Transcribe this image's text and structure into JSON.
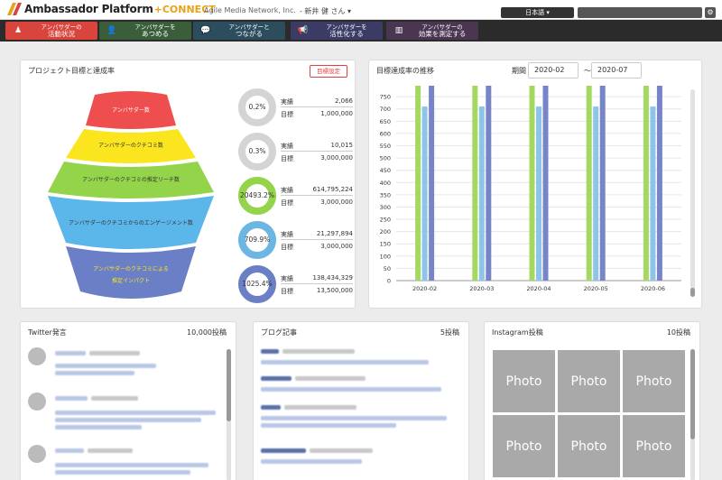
{
  "header": {
    "logo_text": "Ambassador Platform",
    "logo_plus": "+CONNECT",
    "company": "Agile Media Network, Inc.",
    "user": "- 新井 健 さん ▾",
    "language": "日本語 ▾",
    "brand_color": "#e8a21a"
  },
  "nav": {
    "items": [
      {
        "top": "アンバサダーの",
        "main": "活動状況",
        "icon": "person-icon",
        "color": "#d9443c"
      },
      {
        "top": "アンバサダーを",
        "main": "あつめる",
        "icon": "add-user-icon",
        "color": "#3a5e3a"
      },
      {
        "top": "アンバサダーと",
        "main": "つながる",
        "icon": "chat-icon",
        "color": "#2b4d5e"
      },
      {
        "top": "アンバサダーを",
        "main": "活性化する",
        "icon": "megaphone-icon",
        "color": "#3b3b66"
      },
      {
        "top": "アンバサダーの",
        "main": "効果を測定する",
        "icon": "chart-icon",
        "color": "#4a3650"
      }
    ]
  },
  "goals_panel": {
    "title": "プロジェクト目標と達成率",
    "goal_button": "目標設定",
    "funnel": [
      {
        "label": "アンバサダー数",
        "color": "#ef4e4e"
      },
      {
        "label": "アンバサダーのクチコミ数",
        "color": "#fbe51f"
      },
      {
        "label": "アンバサダーのクチコミの推定リーチ数",
        "color": "#93d44a"
      },
      {
        "label": "アンバサダーのクチコミからのエンゲージメント数",
        "color": "#5bb6ea"
      },
      {
        "label": "アンバサダーのクチコミによる",
        "label2": "推定インパクト",
        "color": "#6b7fc6"
      }
    ],
    "metrics": [
      {
        "rate_text": "0.2%",
        "rate": 0.002,
        "actual_label": "実績",
        "actual": "2,066",
        "target_label": "目標",
        "target": "1,000,000",
        "color": "#cccccc"
      },
      {
        "rate_text": "0.3%",
        "rate": 0.003,
        "actual_label": "実績",
        "actual": "10,015",
        "target_label": "目標",
        "target": "3,000,000",
        "color": "#cccccc"
      },
      {
        "rate_text": "20493.2%",
        "rate": 1,
        "actual_label": "実績",
        "actual": "614,795,224",
        "target_label": "目標",
        "target": "3,000,000",
        "color": "#93d44a"
      },
      {
        "rate_text": "709.9%",
        "rate": 1,
        "actual_label": "実績",
        "actual": "21,297,894",
        "target_label": "目標",
        "target": "3,000,000",
        "color": "#6cb6e4"
      },
      {
        "rate_text": "1025.4%",
        "rate": 1,
        "actual_label": "実績",
        "actual": "138,434,329",
        "target_label": "目標",
        "target": "13,500,000",
        "color": "#6b7fc6"
      }
    ]
  },
  "trend_panel": {
    "title": "目標達成率の推移",
    "period_label": "期間",
    "from": "2020-02",
    "separator": "〜",
    "to": "2020-07"
  },
  "chart_data": {
    "type": "bar",
    "categories": [
      "2020-02",
      "2020-03",
      "2020-04",
      "2020-05",
      "2020-06"
    ],
    "series": [
      {
        "values": [
          800,
          800,
          800,
          800,
          800
        ],
        "color": "#a5d860"
      },
      {
        "values": [
          710,
          710,
          710,
          710,
          710
        ],
        "color": "#8fc4ea"
      },
      {
        "values": [
          800,
          800,
          800,
          800,
          800
        ],
        "color": "#7884c8"
      }
    ],
    "yticks": [
      0,
      50,
      100,
      150,
      200,
      250,
      300,
      350,
      400,
      450,
      500,
      550,
      600,
      650,
      700,
      750
    ],
    "ylim": [
      0,
      780
    ],
    "grid": true
  },
  "twitter_panel": {
    "title": "Twitter発言",
    "count": "10,000投稿"
  },
  "blog_panel": {
    "title": "ブログ記事",
    "count": "5投稿"
  },
  "instagram_panel": {
    "title": "Instagram投稿",
    "count": "10投稿",
    "photos": [
      "Photo",
      "Photo",
      "Photo",
      "Photo",
      "Photo",
      "Photo"
    ]
  }
}
